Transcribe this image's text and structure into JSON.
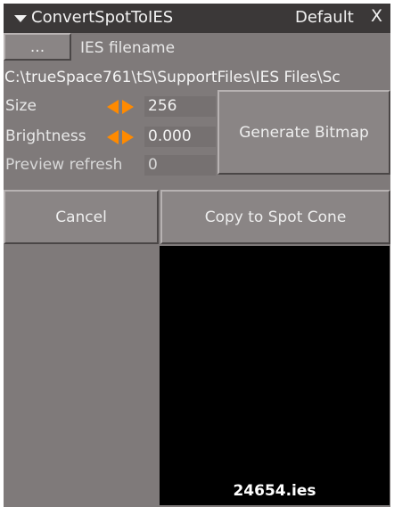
{
  "titlebar": {
    "title": "ConvertSpotToIES",
    "preset": "Default",
    "close_label": "X"
  },
  "file": {
    "browse_label": "...",
    "label": "IES filename",
    "path": "C:\\trueSpace761\\tS\\SupportFiles\\IES Files\\Sc"
  },
  "params": {
    "size_label": "Size",
    "size_value": "256",
    "brightness_label": "Brightness",
    "brightness_value": "0.000",
    "preview_label": "Preview refresh",
    "preview_value": "0"
  },
  "buttons": {
    "generate": "Generate Bitmap",
    "cancel": "Cancel",
    "copy": "Copy to Spot Cone"
  },
  "preview": {
    "filename": "24654.ies"
  },
  "colors": {
    "panel": "#7f7a7a",
    "titlebar": "#3b3838",
    "spinner_accent": "#ff8a00",
    "preview_bg": "#000000"
  },
  "icons": {
    "collapse": "triangle-down-icon",
    "spinner_left": "arrow-left-icon",
    "spinner_right": "arrow-right-icon"
  }
}
